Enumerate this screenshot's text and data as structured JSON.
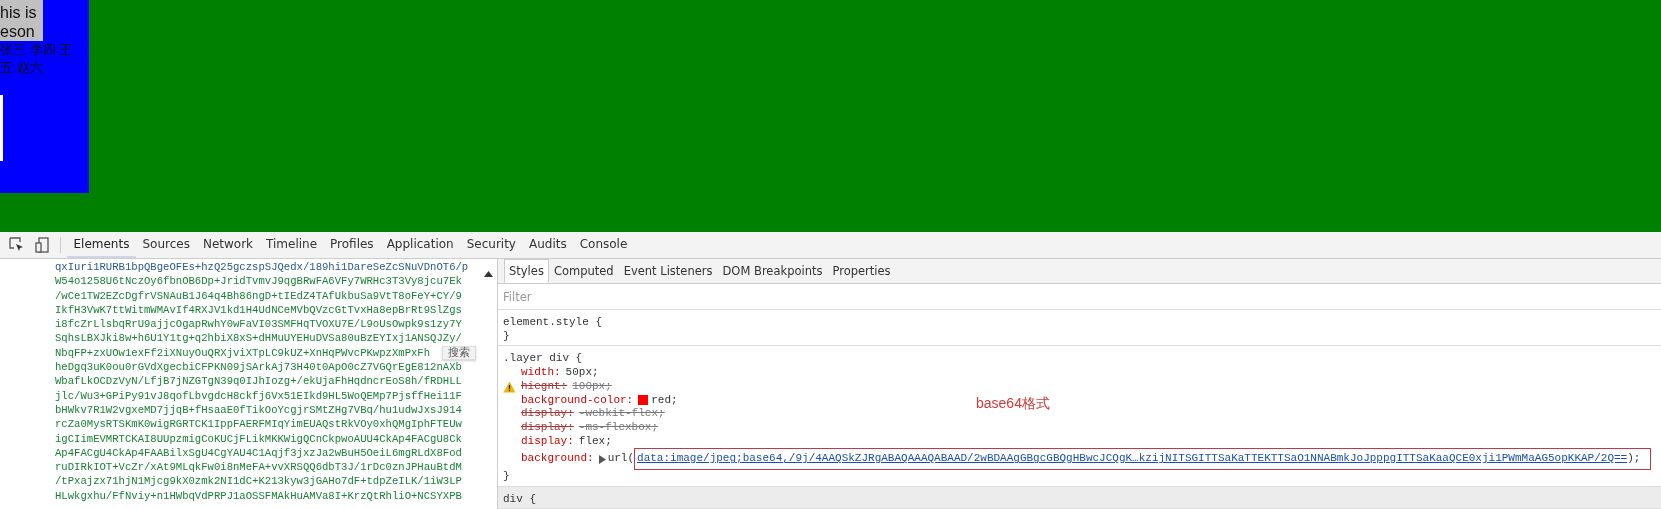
{
  "page": {
    "text_lines": [
      "his is",
      "eson"
    ],
    "name_lines": [
      "张三 李四 王",
      "五 赵六"
    ]
  },
  "devtools": {
    "tabs": [
      {
        "label": "Elements",
        "selected": true
      },
      {
        "label": "Sources",
        "selected": false
      },
      {
        "label": "Network",
        "selected": false
      },
      {
        "label": "Timeline",
        "selected": false
      },
      {
        "label": "Profiles",
        "selected": false
      },
      {
        "label": "Application",
        "selected": false
      },
      {
        "label": "Security",
        "selected": false
      },
      {
        "label": "Audits",
        "selected": false
      },
      {
        "label": "Console",
        "selected": false
      }
    ],
    "elements_lines": [
      "qxIuri1RURB1bpQBgeOFEs+hzQ25gczspSJQedx/189hi1DareSeZcSNuVDnOT6/p",
      "W54o1258U6tNczOy6fbnOB6Dp+JridTvmvJ9qgBRwFA6VFy7WRHc3T3Vy8jcu7Ek",
      "/wCe1TW2EZcDgfrVSNAuB1J64q4Bh86ngD+tIEdZ4TAfUkbuSa9VtT8oFeY+CY/9",
      "IkfH3VwK7ttWitmWMAvIf4RXJV1kd1H4UdNCeMVbQVzcGtTvxHa8epBrRt9SlZgs",
      "i8fcZrLlsbqRrU9ajjcOgapRwhY0wFaVI03SMFHqTVOXU7E/L9oUsOwpk9s1zy7Y",
      "SqhsLBXJki8w+h6U1Y1tg+q2hbiX8xS+dHMuUYEHuDVSa80uBzEYIxj1ANSQJZy/",
      "NbqFP+zxUOw1exFf2iXNuyOuQRXjviXTpLC9kUZ+XnHqPWvcPKwpzXmPxFh",
      "heDgq3uK0ou0rGVdXgecbiCFPKN09jSArkAj73H40t0ApO0cZ7VGQrEgE812nAXb",
      "WbafLkOCDzVyN/LfjB7jNZGTgN39q0IJhIozg+/ekUjaFhHqdncrEoS8h/fRDHLL",
      "jlc/Wu3+GPiPy91vJ8qofLbvgdcH8ckfj6Vx51EIkd9HL5WoQEMp7PjsffHei11F",
      "bHWkv7R1W2vgxeMD7jjqB+fHsaaE0fTikOoYcgjrSMtZHg7VBq/hu1udwJxsJ914",
      "rcZa0MysRTSKmK0wigRGRTCK1IppFAERFMIqYimEUAQstRkVOy0xhQMgIphFTEUw",
      "igCIimEVMRTCKAI8UUpzmigCoKUCjFLikMKKWigQCnCkpwoAUU4CkAp4FACgU8Ck",
      "Ap4FACgU4CkAp4FAABilxSgU4CgYAU4C1Aqjf3jxzJa2wBuH5OeiL6mgRLdX8Fod",
      "ruDIRkIOT+VcZr/xAt9MLqkFw0i8nMeFA+vvXRSQQ6dbT3J/1rDc0znJPHauBtdM",
      "/tPxajzx71hjN1Mjcg9kX0zmk2NI1dC+K213kyw3jGAHo7dF+tdpZeILK/1iW3LP",
      "HLwkgxhu/FfNviy+n1HWbqVdPRPJ1aOSSFMAkHuAMVa8I+KrzQtRhliO+NCSYXPB"
    ],
    "tooltip": "搜索",
    "styles": {
      "tabs": [
        {
          "label": "Styles",
          "selected": true
        },
        {
          "label": "Computed",
          "selected": false
        },
        {
          "label": "Event Listeners",
          "selected": false
        },
        {
          "label": "DOM Breakpoints",
          "selected": false
        },
        {
          "label": "Properties",
          "selected": false
        }
      ],
      "filter_placeholder": "Filter",
      "rules": [
        {
          "selector": "element.style {",
          "close": "}"
        },
        {
          "selector": ".layer div {",
          "close": "}",
          "declarations": [
            {
              "kind": "plain",
              "property": "width:",
              "value": "50px;",
              "struck": false,
              "warning": false
            },
            {
              "kind": "plain",
              "property": "hiegnt:",
              "value": "100px;",
              "struck": true,
              "warning": true
            },
            {
              "kind": "color",
              "property": "background-color:",
              "value": "red;",
              "color": "#ff0000",
              "struck": false,
              "warning": false
            },
            {
              "kind": "plain",
              "property": "display:",
              "value": "-webkit-flex;",
              "struck": true,
              "warning": false
            },
            {
              "kind": "plain",
              "property": "display:",
              "value": "-ms-flexbox;",
              "struck": true,
              "warning": false
            },
            {
              "kind": "plain",
              "property": "display:",
              "value": "flex;",
              "struck": false,
              "warning": false
            },
            {
              "kind": "url",
              "property": "background:",
              "value": "url(",
              "link": "data:image/jpeg;base64,/9j/4AAQSkZJRgABAQAAAQABAAD/2wBDAAgGBgcGBQgHBwcJCQgK…kzijNITSGITTSaKaTTEKTTSaO1NNABmkJoJpppgITTSaKaaQCE0xji1PWmMaAG5opKKAP/2Q==",
              "after": ");",
              "struck": false,
              "warning": false
            }
          ]
        },
        {
          "selector": "div {"
        }
      ]
    },
    "annotation": "base64格式"
  }
}
